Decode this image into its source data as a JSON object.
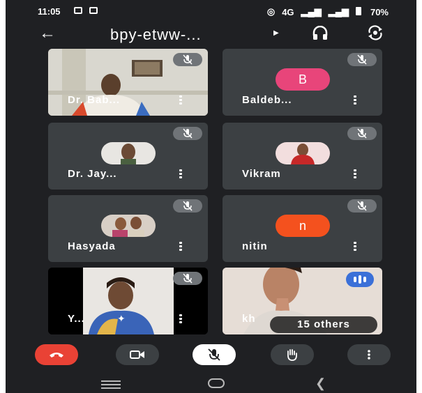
{
  "status_bar": {
    "time": "11:05",
    "network": "4G",
    "battery": "70%"
  },
  "top_bar": {
    "title": "bpy-etww-..."
  },
  "participants": [
    {
      "name": "Dr. Bab..."
    },
    {
      "name": "Baldeb...",
      "initial": "B",
      "avatar_color": "#e8457a"
    },
    {
      "name": "Dr. Jay..."
    },
    {
      "name": "Vikram"
    },
    {
      "name": "Hasyada"
    },
    {
      "name": "nitin",
      "initial": "n",
      "avatar_color": "#f4511e"
    },
    {
      "name": "Y..."
    },
    {
      "name": "kh"
    }
  ],
  "others": {
    "label": "15 others"
  },
  "colors": {
    "background": "#1f2023",
    "tile": "#3c4043",
    "end_call": "#e94235",
    "speaking": "#3b70d8"
  },
  "icons": {
    "controls": [
      "end-call-icon",
      "camera-icon",
      "mic-off-icon",
      "raise-hand-icon",
      "more-vertical-icon"
    ]
  }
}
